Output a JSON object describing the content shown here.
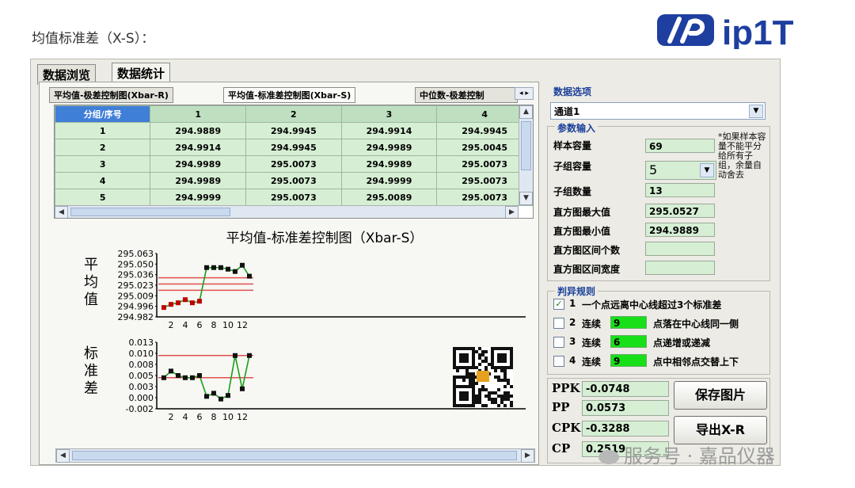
{
  "page": {
    "heading": "均值标准差（X-S）："
  },
  "logo": {
    "text": "ip1T"
  },
  "tabs": [
    {
      "label": "数据浏览"
    },
    {
      "label": "数据统计"
    }
  ],
  "subtabs": [
    {
      "label": "平均值-极差控制图(Xbar-R)"
    },
    {
      "label": "平均值-标准差控制图(Xbar-S)"
    },
    {
      "label": "中位数-极差控制"
    }
  ],
  "table": {
    "columns": [
      "分组/序号",
      "1",
      "2",
      "3",
      "4"
    ],
    "rows": [
      [
        "1",
        "294.9889",
        "294.9945",
        "294.9914",
        "294.9945"
      ],
      [
        "2",
        "294.9914",
        "294.9945",
        "294.9989",
        "295.0045"
      ],
      [
        "3",
        "294.9989",
        "295.0073",
        "294.9989",
        "295.0073"
      ],
      [
        "4",
        "294.9989",
        "295.0073",
        "294.9999",
        "295.0073"
      ],
      [
        "5",
        "294.9999",
        "295.0073",
        "295.0089",
        "295.0073"
      ]
    ]
  },
  "chart_data": [
    {
      "type": "line",
      "title": "平均值-标准差控制图（Xbar-S）",
      "ylabel": "平均值",
      "yticks": [
        "295.063",
        "295.050",
        "295.036",
        "295.023",
        "295.009",
        "294.996",
        "294.982"
      ],
      "xticks": [
        "2",
        "4",
        "6",
        "8",
        "10",
        "12"
      ],
      "ylim": [
        294.982,
        295.063
      ],
      "x": [
        1,
        2,
        3,
        4,
        5,
        6,
        7,
        8,
        9,
        10,
        11,
        12,
        13
      ],
      "values": [
        294.994,
        294.998,
        295.0,
        295.004,
        295.0,
        295.002,
        295.045,
        295.045,
        295.045,
        295.043,
        295.04,
        295.048,
        295.034
      ],
      "control_limits": [
        295.032,
        295.024,
        295.016
      ],
      "colors": {
        "line": "#1a9f1a",
        "limit": "#e05050",
        "point_in": "#c00000",
        "point_out": "#111111"
      }
    },
    {
      "type": "line",
      "ylabel": "标准差",
      "yticks": [
        "0.013",
        "0.010",
        "0.008",
        "0.005",
        "0.003",
        "0.000",
        "-0.002"
      ],
      "xticks": [
        "2",
        "4",
        "6",
        "8",
        "10",
        "12"
      ],
      "ylim": [
        -0.002,
        0.013
      ],
      "x": [
        1,
        2,
        3,
        4,
        5,
        6,
        7,
        8,
        9,
        10,
        11,
        12,
        13
      ],
      "values": [
        0.005,
        0.0065,
        0.0055,
        0.005,
        0.005,
        0.0055,
        0.0008,
        0.0015,
        0.0002,
        0.001,
        0.01,
        0.0025,
        0.01
      ],
      "control_limits": [
        0.01,
        0.005
      ],
      "colors": {
        "line": "#1a9f1a",
        "limit": "#e05050",
        "point": "#111111"
      }
    }
  ],
  "data_options": {
    "title": "数据选项",
    "channel": "通道1"
  },
  "params": {
    "title": "参数输入",
    "note": "*如果样本容量不能平分给所有子组，余量自动舍去",
    "sample_size": {
      "label": "样本容量",
      "value": "69"
    },
    "subgroup_size": {
      "label": "子组容量",
      "value": "5"
    },
    "subgroup_count": {
      "label": "子组数量",
      "value": "13"
    },
    "hist_max": {
      "label": "直方图最大值",
      "value": "295.0527"
    },
    "hist_min": {
      "label": "直方图最小值",
      "value": "294.9889"
    },
    "hist_bins": {
      "label": "直方图区间个数",
      "value": ""
    },
    "hist_width": {
      "label": "直方图区间宽度",
      "value": ""
    }
  },
  "rules": {
    "title": "判异规则",
    "r1": {
      "checked": "✓",
      "num": "1",
      "text": "一个点远离中心线超过3个标准差"
    },
    "r2": {
      "num": "2",
      "prefix": "连续",
      "value": "9",
      "text": "点落在中心线同一侧"
    },
    "r3": {
      "num": "3",
      "prefix": "连续",
      "value": "6",
      "text": "点递增或递减"
    },
    "r4": {
      "num": "4",
      "prefix": "连续",
      "value": "9",
      "text": "点中相邻点交替上下"
    }
  },
  "capability": {
    "ppk": {
      "label": "PPK",
      "value": "-0.0748"
    },
    "pp": {
      "label": "PP",
      "value": "0.0573"
    },
    "cpk": {
      "label": "CPK",
      "value": "-0.3288"
    },
    "cp": {
      "label": "CP",
      "value": "0.2519"
    }
  },
  "buttons": {
    "save": "保存图片",
    "export": "导出X-R"
  },
  "watermark": {
    "text": "服务号 · 嘉品仪器"
  }
}
